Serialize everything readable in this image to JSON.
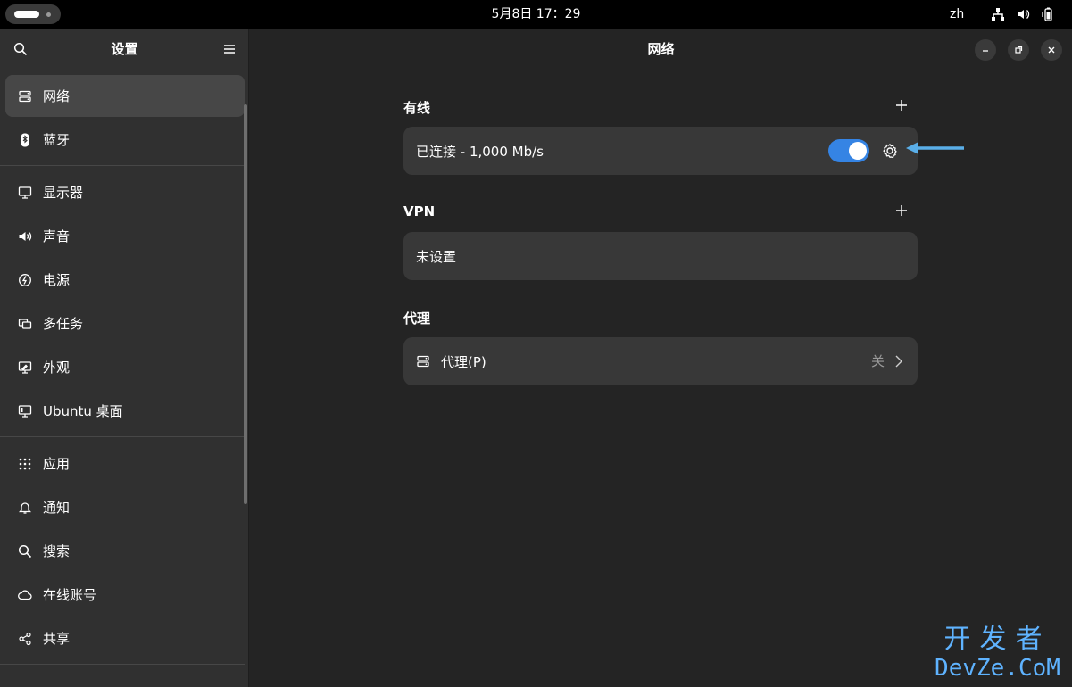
{
  "topbar": {
    "clock": "5月8日  17：29",
    "language": "zh"
  },
  "sidebar": {
    "title": "设置",
    "groups": [
      [
        {
          "label": "网络",
          "icon": "network-icon",
          "active": true
        },
        {
          "label": "蓝牙",
          "icon": "bluetooth-icon"
        }
      ],
      [
        {
          "label": "显示器",
          "icon": "display-icon"
        },
        {
          "label": "声音",
          "icon": "speaker-icon"
        },
        {
          "label": "电源",
          "icon": "power-icon"
        },
        {
          "label": "多任务",
          "icon": "multitasking-icon"
        },
        {
          "label": "外观",
          "icon": "appearance-icon"
        },
        {
          "label": "Ubuntu 桌面",
          "icon": "ubuntu-desktop-icon"
        }
      ],
      [
        {
          "label": "应用",
          "icon": "apps-icon"
        },
        {
          "label": "通知",
          "icon": "bell-icon"
        },
        {
          "label": "搜索",
          "icon": "search-icon"
        },
        {
          "label": "在线账号",
          "icon": "cloud-icon"
        },
        {
          "label": "共享",
          "icon": "share-icon"
        }
      ]
    ]
  },
  "main": {
    "title": "网络",
    "wired": {
      "title": "有线",
      "status": "已连接 - 1,000 Mb/s",
      "enabled": true
    },
    "vpn": {
      "title": "VPN",
      "status": "未设置"
    },
    "proxy": {
      "title": "代理",
      "label": "代理(P)",
      "value": "关"
    }
  },
  "watermark": {
    "top": "开发者",
    "bottom": "DevZe.CoM"
  },
  "colors": {
    "accent": "#3584e4",
    "annotation_arrow": "#5aaee8"
  }
}
